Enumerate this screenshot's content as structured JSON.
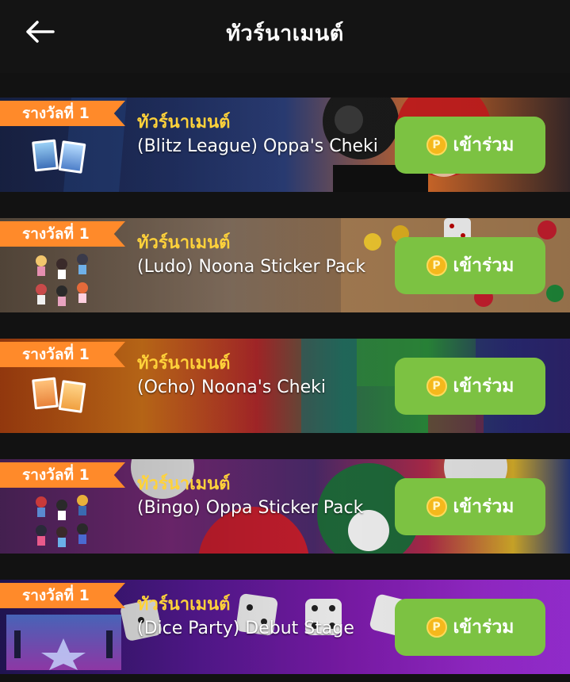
{
  "header": {
    "title": "ทัวร์นาเมนต์",
    "back_icon": "arrow-left-icon"
  },
  "join_coin_icon": "P",
  "tournaments": [
    {
      "ribbon": "รางวัลที่ 1",
      "label": "ทัวร์นาเมนต์",
      "name": "(Blitz League) Oppa's Cheki",
      "button": "เข้าร่วม",
      "thumb": "cheki-photos",
      "theme": "blitz"
    },
    {
      "ribbon": "รางวัลที่ 1",
      "label": "ทัวร์นาเมนต์",
      "name": "(Ludo) Noona Sticker Pack",
      "button": "เข้าร่วม",
      "thumb": "sticker-pack",
      "theme": "ludo"
    },
    {
      "ribbon": "รางวัลที่ 1",
      "label": "ทัวร์นาเมนต์",
      "name": "(Ocho) Noona's Cheki",
      "button": "เข้าร่วม",
      "thumb": "cheki-photos",
      "theme": "ocho"
    },
    {
      "ribbon": "รางวัลที่ 1",
      "label": "ทัวร์นาเมนต์",
      "name": "(Bingo) Oppa Sticker Pack",
      "button": "เข้าร่วม",
      "thumb": "sticker-pack",
      "theme": "bingo"
    },
    {
      "ribbon": "รางวัลที่ 1",
      "label": "ทัวร์นาเมนต์",
      "name": "(Dice Party) Debut Stage",
      "button": "เข้าร่วม",
      "thumb": "debut-stage",
      "theme": "dice"
    }
  ],
  "colors": {
    "accent_green": "#7cc242",
    "ribbon_orange": "#ff8a2a",
    "label_yellow": "#ffd23a",
    "background": "#121212"
  }
}
